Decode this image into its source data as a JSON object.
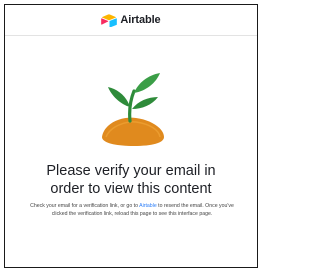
{
  "header": {
    "brand_name": "Airtable",
    "logo_icon": "airtable-logo-icon",
    "logo_colors": {
      "yellow": "#FCB400",
      "blue": "#18BFFF",
      "red": "#F82B60"
    }
  },
  "illustration": {
    "icon": "sprout-icon",
    "leaf_color": "#2E8B3A",
    "soil_color": "#E08A1E"
  },
  "main": {
    "heading_line1": "Please verify your email in",
    "heading_line2": "order to view this content",
    "body_before_link": "Check your email for a verification link, or go to ",
    "link_text": "Airtable",
    "body_after_link": " to resend the email. Once you've clicked the verification link, reload this page to see this interface page."
  }
}
